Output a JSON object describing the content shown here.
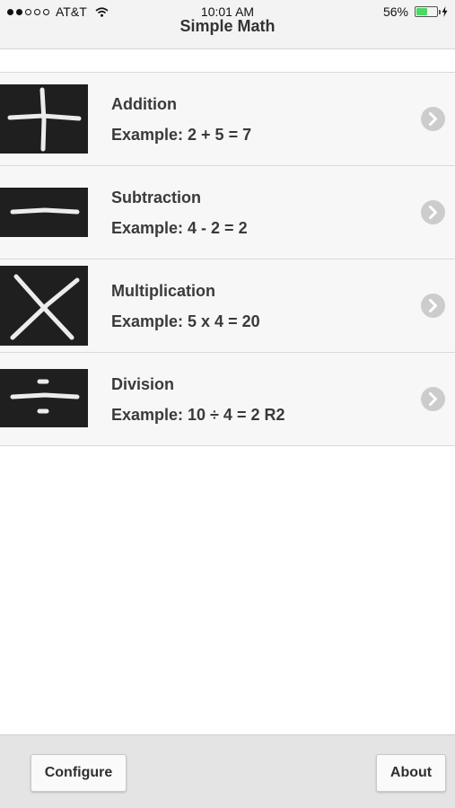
{
  "status_bar": {
    "carrier": "AT&T",
    "time": "10:01 AM",
    "battery_percent": "56%",
    "battery_level": 0.56,
    "signal_bars_filled": 2,
    "signal_bars_total": 5
  },
  "nav": {
    "title": "Simple Math"
  },
  "operations": [
    {
      "title": "Addition",
      "example": "Example: 2 + 5 = 7",
      "icon": "plus-chalk-icon"
    },
    {
      "title": "Subtraction",
      "example": "Example: 4 - 2 = 2",
      "icon": "minus-chalk-icon"
    },
    {
      "title": "Multiplication",
      "example": "Example: 5 x 4 = 20",
      "icon": "times-chalk-icon"
    },
    {
      "title": "Division",
      "example": "Example: 10 ÷ 4 = 2 R2",
      "icon": "divide-chalk-icon"
    }
  ],
  "toolbar": {
    "configure_label": "Configure",
    "about_label": "About"
  },
  "colors": {
    "battery_fill": "#4cd964",
    "chalkboard": "#1f1f1f",
    "chevron": "#cccccc"
  }
}
